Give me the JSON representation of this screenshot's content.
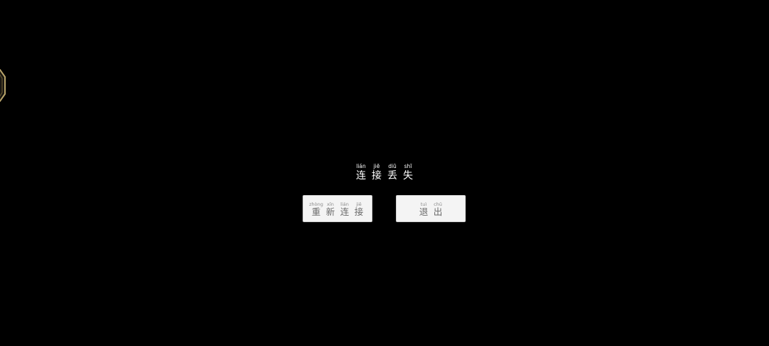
{
  "colors": {
    "background": "#000000",
    "title_text": "#ffffff",
    "button_bg": "#f4f4f4",
    "button_text": "#6a6a6a",
    "badge_border": "#b8a46a"
  },
  "icons": {
    "edge_badge": "octagon-badge-icon"
  },
  "dialog": {
    "title": [
      {
        "pinyin": "lián",
        "hanzi": "连"
      },
      {
        "pinyin": "jiē",
        "hanzi": "接"
      },
      {
        "pinyin": "diū",
        "hanzi": "丢"
      },
      {
        "pinyin": "shī",
        "hanzi": "失"
      }
    ],
    "reconnect_button": [
      {
        "pinyin": "zhòng",
        "hanzi": "重"
      },
      {
        "pinyin": "xīn",
        "hanzi": "新"
      },
      {
        "pinyin": "lián",
        "hanzi": "连"
      },
      {
        "pinyin": "jiē",
        "hanzi": "接"
      }
    ],
    "exit_button": [
      {
        "pinyin": "tuì",
        "hanzi": "退"
      },
      {
        "pinyin": "chū",
        "hanzi": "出"
      }
    ]
  }
}
